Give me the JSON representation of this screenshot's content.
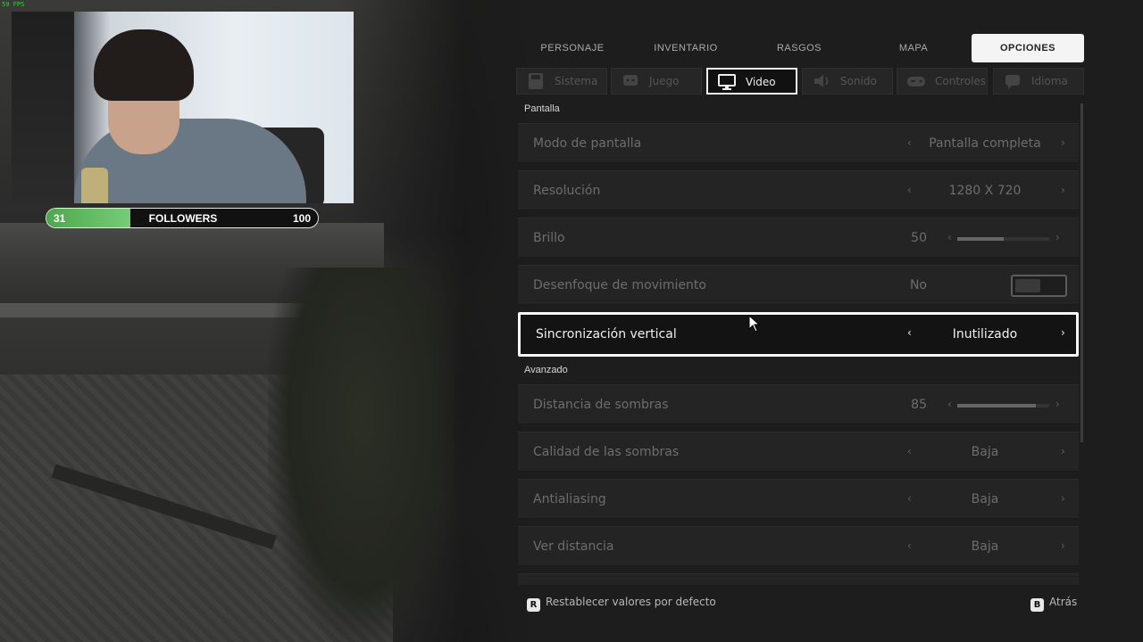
{
  "overlay": {
    "fps_text": "59 FPS",
    "followers": {
      "current": "31",
      "label": "FOLLOWERS",
      "goal": "100",
      "progress": 0.31
    }
  },
  "tabs": [
    {
      "label": "PERSONAJE",
      "active": false
    },
    {
      "label": "INVENTARIO",
      "active": false
    },
    {
      "label": "RASGOS",
      "active": false
    },
    {
      "label": "MAPA",
      "active": false
    },
    {
      "label": "OPCIONES",
      "active": true
    }
  ],
  "subtabs": [
    {
      "label": "Sistema",
      "icon": "save-icon"
    },
    {
      "label": "Juego",
      "icon": "chat-icon"
    },
    {
      "label": "Video",
      "icon": "monitor-icon",
      "active": true
    },
    {
      "label": "Sonido",
      "icon": "speaker-icon"
    },
    {
      "label": "Controles",
      "icon": "gamepad-icon"
    },
    {
      "label": "Idioma",
      "icon": "language-icon"
    }
  ],
  "sections": {
    "display": "Pantalla",
    "advanced": "Avanzado"
  },
  "settings": {
    "screen_mode": {
      "name": "Modo de pantalla",
      "value": "Pantalla completa"
    },
    "resolution": {
      "name": "Resolución",
      "value": "1280 X 720"
    },
    "brightness": {
      "name": "Brillo",
      "value": "50",
      "level": 0.5
    },
    "motion_blur": {
      "name": "Desenfoque de movimiento",
      "value": "No",
      "enabled": false
    },
    "vsync": {
      "name": "Sincronización vertical",
      "value": "Inutilizado"
    },
    "shadow_distance": {
      "name": "Distancia de sombras",
      "value": "85",
      "level": 0.85
    },
    "shadow_quality": {
      "name": "Calidad de las sombras",
      "value": "Baja"
    },
    "antialiasing": {
      "name": "Antialiasing",
      "value": "Baja"
    },
    "view_distance": {
      "name": "Ver distancia",
      "value": "Baja"
    }
  },
  "footer": {
    "reset_key": "R",
    "reset_label": "Restablecer valores por defecto",
    "back_key": "B",
    "back_label": "Atrás"
  },
  "colors": {
    "accent": "#f4f4f4",
    "followers_fill": "#5cbf5c",
    "fps": "#3ccf3c"
  }
}
